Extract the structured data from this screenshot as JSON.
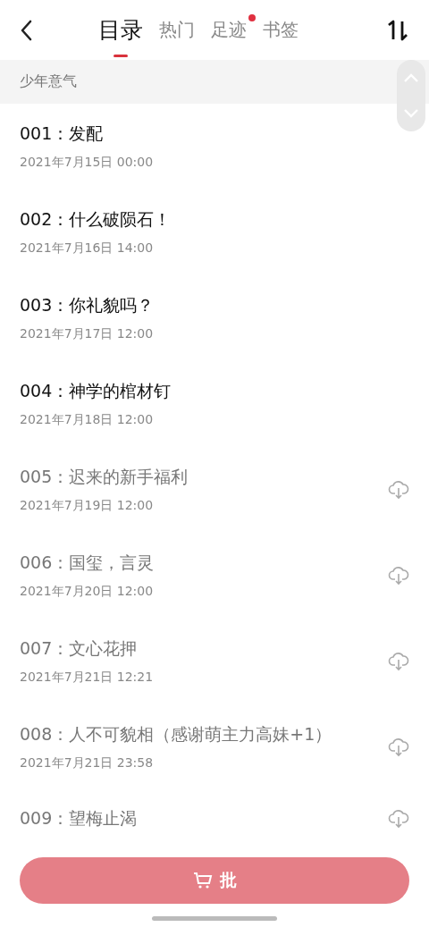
{
  "tabs": [
    {
      "label": "目录",
      "selected": true,
      "badge": false
    },
    {
      "label": "热门",
      "selected": false,
      "badge": false
    },
    {
      "label": "足迹",
      "selected": false,
      "badge": true
    },
    {
      "label": "书签",
      "selected": false,
      "badge": false
    }
  ],
  "section": {
    "title": "少年意气"
  },
  "chapters": [
    {
      "title": "001：发配",
      "date": "2021年7月15日 00:00",
      "downloaded": true
    },
    {
      "title": "002：什么破陨石！",
      "date": "2021年7月16日 14:00",
      "downloaded": true
    },
    {
      "title": "003：你礼貌吗？",
      "date": "2021年7月17日 12:00",
      "downloaded": true
    },
    {
      "title": "004：神学的棺材钉",
      "date": "2021年7月18日 12:00",
      "downloaded": true
    },
    {
      "title": "005：迟来的新手福利",
      "date": "2021年7月19日 12:00",
      "downloaded": false
    },
    {
      "title": "006：国玺，言灵",
      "date": "2021年7月20日 12:00",
      "downloaded": false
    },
    {
      "title": "007：文心花押",
      "date": "2021年7月21日 12:21",
      "downloaded": false
    },
    {
      "title": "008：人不可貌相（感谢萌主力高妹+1）",
      "date": "2021年7月21日 23:58",
      "downloaded": false
    },
    {
      "title": "009：望梅止渴",
      "downloaded": false
    }
  ],
  "bottom_button": {
    "label": "批"
  }
}
